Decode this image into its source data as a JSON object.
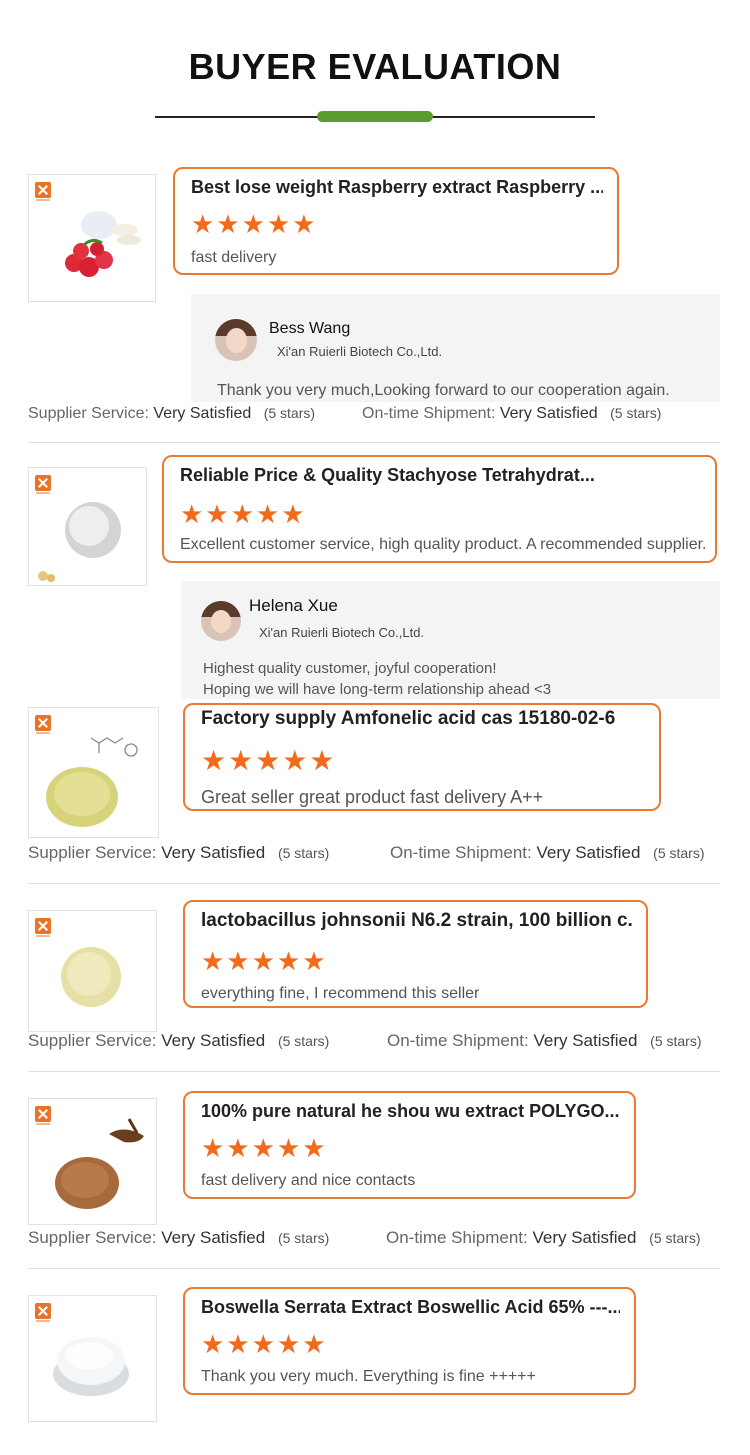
{
  "header": {
    "title": "BUYER EVALUATION",
    "accent_color": "#5b9b2f"
  },
  "star_color": "#f26a1b",
  "card_border_color": "#ea7a32",
  "labels": {
    "supplier_service": "Supplier Service:",
    "ontime_shipment": "On-time Shipment:",
    "very_satisfied": "Very Satisfied",
    "five_stars": "(5 stars)"
  },
  "reviews": [
    {
      "product_title": "Best lose weight Raspberry extract Raspberry ...",
      "stars": "★★★★★",
      "review": "fast delivery",
      "reply": {
        "name": "Bess Wang",
        "company": "Xi'an Ruierli Biotech Co.,Ltd.",
        "message_line1": "Thank you very much,Looking forward to our cooperation again.",
        "message_line2": ""
      }
    },
    {
      "product_title": "Reliable Price & Quality Stachyose Tetrahydrat...",
      "stars": "★★★★★",
      "review": "Excellent customer service, high quality product. A recommended supplier.",
      "reply": {
        "name": "Helena Xue",
        "company": "Xi'an Ruierli Biotech Co.,Ltd.",
        "message_line1": "Highest quality customer, joyful cooperation!",
        "message_line2": "Hoping we will have long-term relationship ahead <3"
      }
    },
    {
      "product_title": "Factory supply Amfonelic acid cas 15180-02-6",
      "stars": "★★★★★",
      "review": "Great seller great product fast delivery A++"
    },
    {
      "product_title": "lactobacillus johnsonii N6.2 strain, 100 billion c...",
      "stars": "★★★★★",
      "review": "everything fine, I recommend this seller"
    },
    {
      "product_title": "100% pure natural he shou wu extract POLYGO...",
      "stars": "★★★★★",
      "review": "fast delivery and nice contacts"
    },
    {
      "product_title": "Boswella Serrata Extract Boswellic Acid 65% ---...",
      "stars": "★★★★★",
      "review": "Thank you very much. Everything is fine +++++"
    }
  ]
}
